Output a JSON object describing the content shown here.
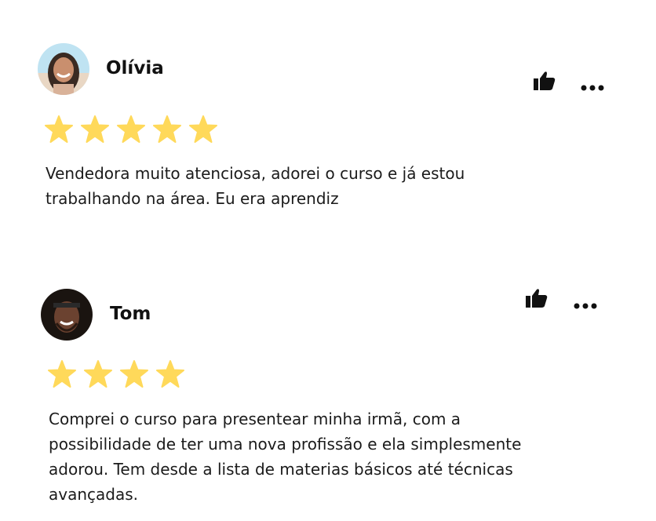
{
  "reviews": [
    {
      "name": "Olívia",
      "rating": 5,
      "text_lines": [
        "Vendedora muito atenciosa, adorei o curso e já estou",
        "trabalhando na área. Eu era aprendiz"
      ],
      "icons": {
        "like": "thumbs-up-icon",
        "menu": "more-options-icon"
      }
    },
    {
      "name": "Tom",
      "rating": 4,
      "text_lines": [
        "Comprei o curso para presentear minha irmã, com a",
        "possibilidade de ter uma nova profissão e ela simplesmente",
        "adorou. Tem desde a lista de materias básicos até técnicas",
        "avançadas."
      ],
      "icons": {
        "like": "thumbs-up-icon",
        "menu": "more-options-icon"
      }
    }
  ],
  "colors": {
    "star": "#FFD95A",
    "icon": "#111111",
    "text": "#1b1b1b"
  }
}
